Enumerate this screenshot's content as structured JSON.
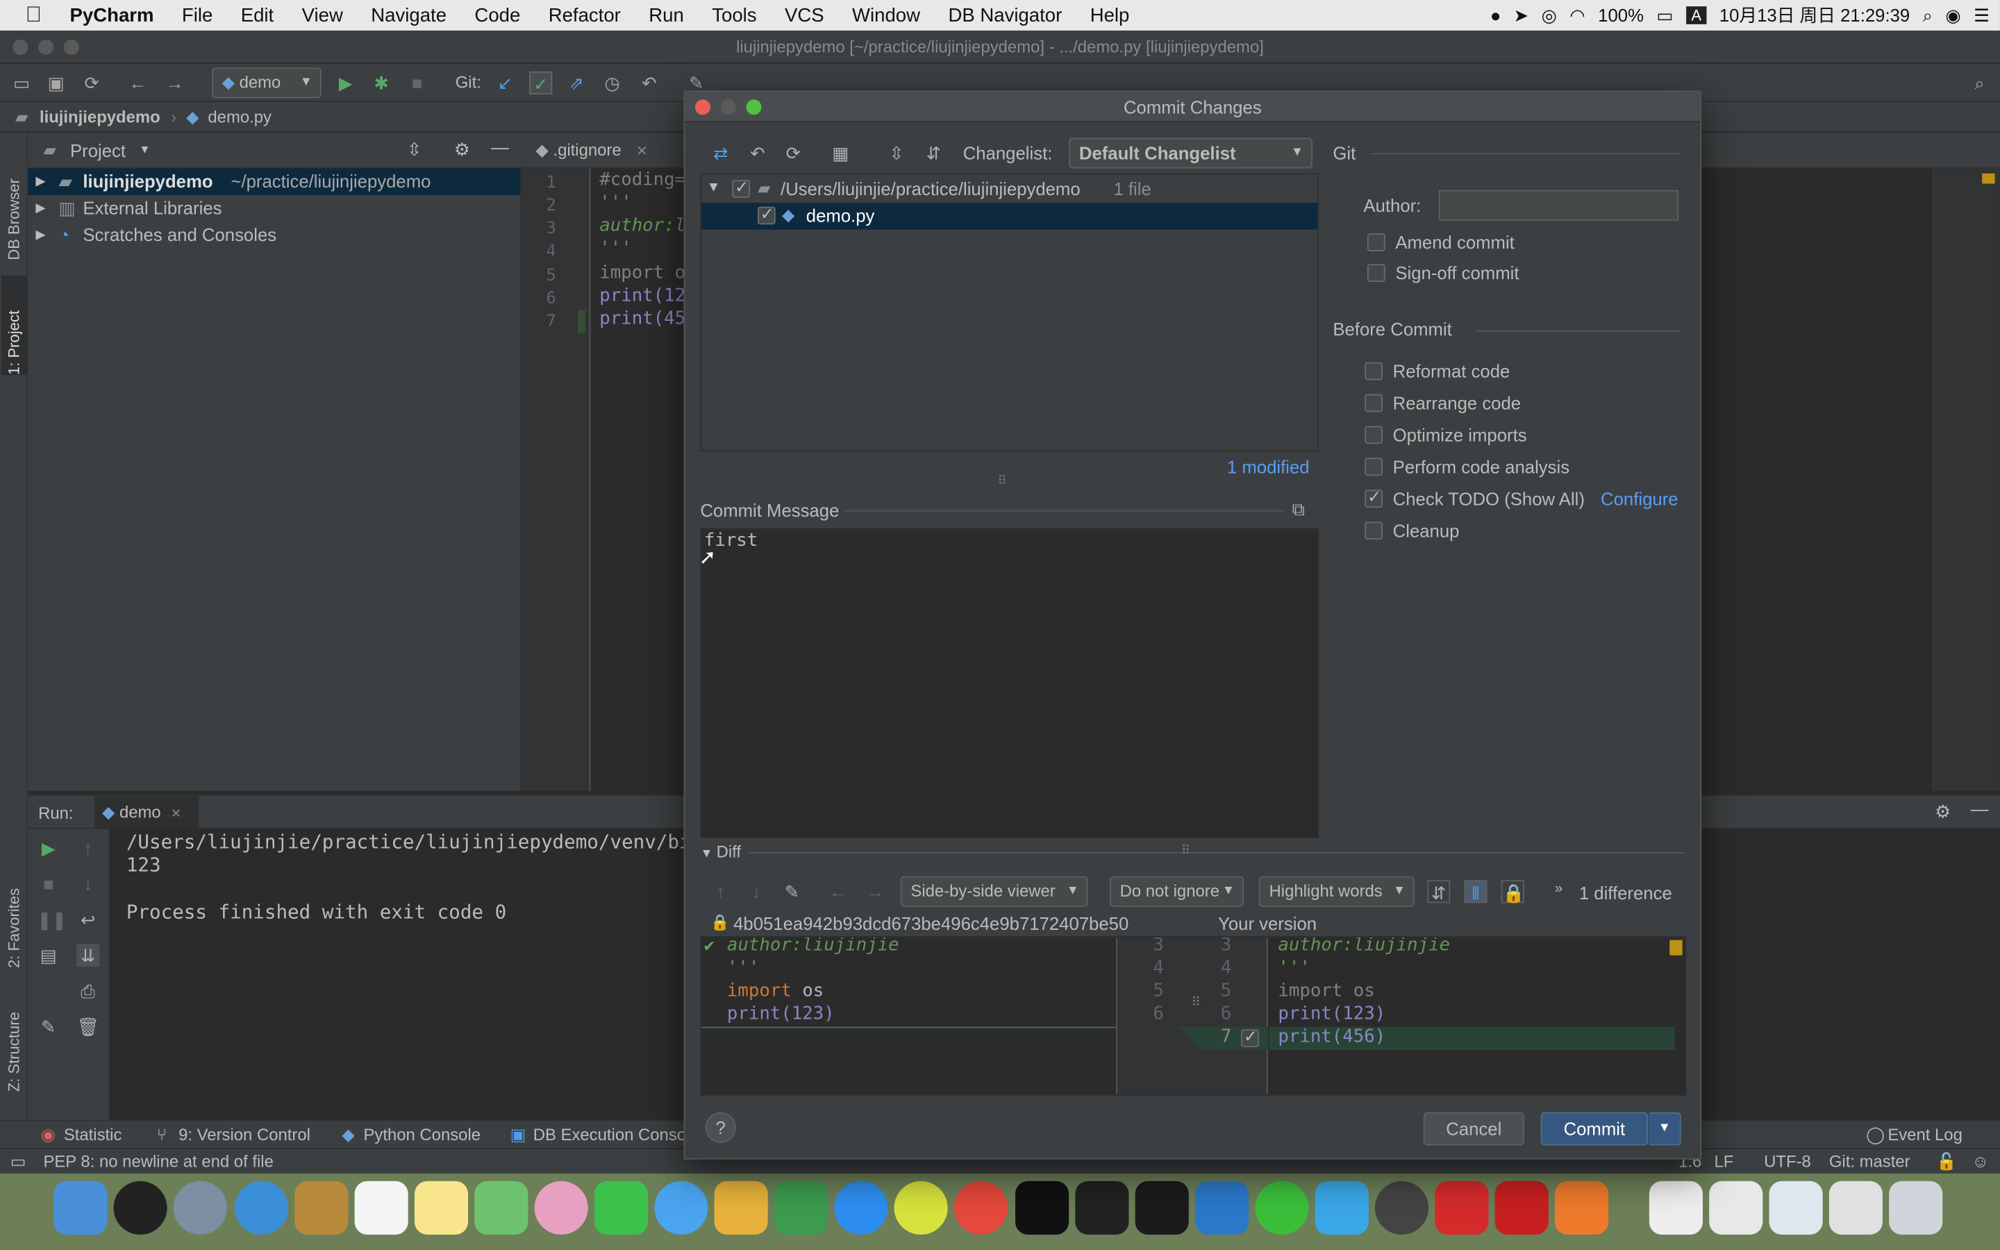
{
  "menubar": {
    "apple": "",
    "app_name": "PyCharm",
    "items": [
      "File",
      "Edit",
      "View",
      "Navigate",
      "Code",
      "Refactor",
      "Run",
      "Tools",
      "VCS",
      "Window",
      "DB Navigator",
      "Help"
    ],
    "battery": "100%",
    "input_method": "A",
    "datetime": "10月13日 周日 21:29:39"
  },
  "window": {
    "title": "liujinjiepydemo [~/practice/liujinjiepydemo] - .../demo.py [liujinjiepydemo]"
  },
  "toolbar": {
    "run_config": "demo",
    "git_label": "Git:"
  },
  "navbar": {
    "project": "liujinjiepydemo",
    "file": "demo.py"
  },
  "left_strip": {
    "db_browser": "DB Browser",
    "project": "1: Project",
    "favorites": "2: Favorites",
    "structure": "Z: Structure"
  },
  "project_panel": {
    "title": "Project",
    "tree": [
      {
        "name": "liujinjiepydemo",
        "path": "~/practice/liujinjiepydemo"
      },
      {
        "name": "External Libraries",
        "path": ""
      },
      {
        "name": "Scratches and Consoles",
        "path": ""
      }
    ]
  },
  "editor": {
    "tab": ".gitignore",
    "line_numbers": [
      "1",
      "2",
      "3",
      "4",
      "5",
      "6",
      "7"
    ],
    "lines": [
      "#coding=",
      "'''",
      "author:l",
      "'''",
      "import o",
      "print(12",
      "print(45"
    ]
  },
  "run_panel": {
    "label": "Run:",
    "tab": "demo",
    "output": [
      "/Users/liujinjie/practice/liujinjiepydemo/venv/bin",
      "123",
      "",
      "Process finished with exit code 0"
    ]
  },
  "tool_tabs": {
    "statistic": "Statistic",
    "version_control": "9: Version Control",
    "python_console": "Python Console",
    "db_exec": "DB Execution Console",
    "event_log": "Event Log"
  },
  "status": {
    "message": "PEP 8: no newline at end of file",
    "position": "1:6",
    "line_sep": "LF",
    "encoding": "UTF-8",
    "git_branch": "Git: master"
  },
  "dialog": {
    "title": "Commit Changes",
    "changelist_label": "Changelist:",
    "changelist_value": "Default Changelist",
    "tree": {
      "root_path": "/Users/liujinjie/practice/liujinjiepydemo",
      "root_count": "1 file",
      "file": "demo.py"
    },
    "modified": "1 modified",
    "commit_message_label": "Commit Message",
    "commit_message": "first",
    "git_section": "Git",
    "author_label": "Author:",
    "author_value": "",
    "amend_commit": "Amend commit",
    "signoff_commit": "Sign-off commit",
    "before_commit": "Before Commit",
    "options": [
      {
        "label": "Reformat code",
        "checked": false
      },
      {
        "label": "Rearrange code",
        "checked": false
      },
      {
        "label": "Optimize imports",
        "checked": false
      },
      {
        "label": "Perform code analysis",
        "checked": false
      },
      {
        "label": "Check TODO (Show All)",
        "checked": true
      },
      {
        "label": "Cleanup",
        "checked": false
      }
    ],
    "configure_link": "Configure",
    "diff_label": "Diff",
    "viewer": "Side-by-side viewer",
    "ignore": "Do not ignore",
    "highlight": "Highlight words",
    "differences": "1 difference",
    "left_hash": "4b051ea942b93dcd673be496c4e9b7172407be50",
    "right_title": "Your version",
    "left_lines": [
      "author:liujinjie",
      "'''",
      "",
      "import os",
      "print(123)"
    ],
    "gutter_left": [
      "3",
      "4",
      "5",
      "6",
      ""
    ],
    "gutter_right": [
      "3",
      "4",
      "5",
      "6",
      "7"
    ],
    "right_lines": [
      "author:liujinjie",
      "'''",
      "import os",
      "print(123)",
      "print(456)"
    ],
    "help": "?",
    "cancel": "Cancel",
    "commit": "Commit"
  },
  "colors": {
    "selection": "#0d293e",
    "accent": "#365880",
    "link": "#589df6",
    "added": "#294436"
  }
}
